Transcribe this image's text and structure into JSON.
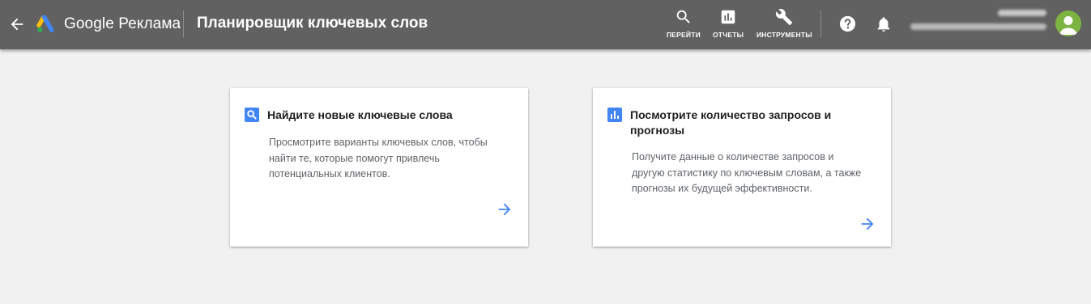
{
  "header": {
    "brand": "Google Реклама",
    "title": "Планировщик ключевых слов",
    "tools": [
      {
        "label": "ПЕРЕЙТИ",
        "icon": "search-icon"
      },
      {
        "label": "ОТЧЕТЫ",
        "icon": "reports-icon"
      },
      {
        "label": "ИНСТРУМЕНТЫ",
        "icon": "wrench-icon"
      }
    ],
    "help_icon": "help-icon",
    "notifications_icon": "bell-icon",
    "colors": {
      "bar": "#616161",
      "accent": "#4285f4",
      "avatar": "#7cb342"
    }
  },
  "cards": [
    {
      "icon": "search-icon",
      "title": "Найдите новые ключевые слова",
      "desc": [
        "Просмотрите варианты ключевых слов, чтобы",
        "найти те, которые помогут привлечь",
        "потенциальных клиентов."
      ]
    },
    {
      "icon": "bar-chart-icon",
      "title": [
        "Посмотрите количество запросов и",
        "прогнозы"
      ],
      "desc": [
        "Получите данные о количестве запросов и",
        "другую статистику по ключевым словам, а также",
        "прогнозы их будущей эффективности."
      ]
    }
  ]
}
